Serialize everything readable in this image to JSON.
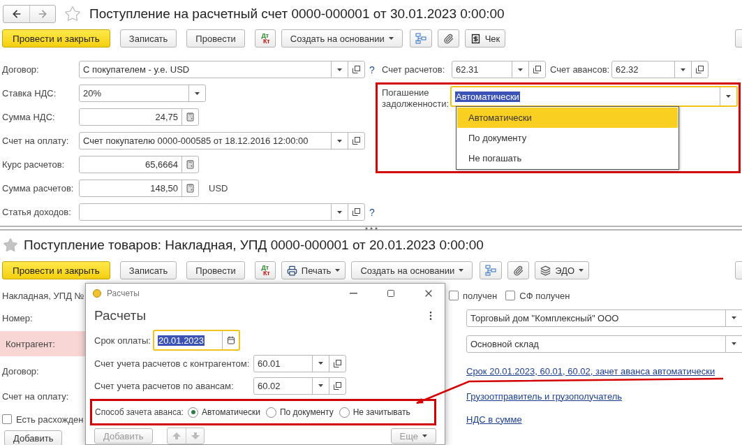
{
  "top_document": {
    "title": "Поступление на расчетный счет 0000-000001 от 30.01.2023 0:00:00",
    "toolbar": [
      {
        "kind": "primary",
        "label": "Провести и закрыть"
      },
      {
        "kind": "button",
        "label": "Записать"
      },
      {
        "kind": "button",
        "label": "Провести"
      },
      {
        "kind": "dtkt",
        "debit": "Дт",
        "credit": "Кт"
      },
      {
        "kind": "menu",
        "label": "Создать на основании"
      },
      {
        "kind": "structure"
      },
      {
        "kind": "clip"
      },
      {
        "kind": "receipt",
        "label": "Чек"
      },
      {
        "kind": "edge"
      }
    ],
    "fields": [
      {
        "kind": "ref",
        "label": "Договор:",
        "value": "С покупателем - у.е. USD",
        "help": "?"
      },
      {
        "kind": "choice",
        "label": "Ставка НДС:",
        "value": "20%"
      },
      {
        "kind": "number",
        "label": "Сумма НДС:",
        "value": "24,75"
      },
      {
        "kind": "ref",
        "label": "Счет на оплату:",
        "value": "Счет покупателю 0000-000585 от 18.12.2016 12:00:00"
      },
      {
        "kind": "number",
        "label": "Курс расчетов:",
        "value": "65,6664"
      },
      {
        "kind": "number",
        "label": "Сумма расчетов:",
        "value": "148,50",
        "unit": "USD"
      },
      {
        "kind": "ref",
        "label": "Статья доходов:",
        "help": "?"
      }
    ],
    "accounts": [
      {
        "label": "Счет расчетов:",
        "value": "62.31"
      },
      {
        "label": "Счет авансов:",
        "value": "62.32"
      }
    ],
    "repayment": {
      "label": "Погашение задолженности:",
      "value": "Автоматически",
      "options": [
        {
          "label": "Автоматически",
          "selected": true
        },
        {
          "label": "По документу",
          "selected": false
        },
        {
          "label": "Не погашать",
          "selected": false
        }
      ]
    }
  },
  "bottom_document": {
    "title": "Поступление товаров: Накладная, УПД 0000-000001 от 20.01.2023 0:00:00",
    "toolbar": [
      {
        "kind": "primary",
        "label": "Провести и закрыть"
      },
      {
        "kind": "button",
        "label": "Записать"
      },
      {
        "kind": "button",
        "label": "Провести"
      },
      {
        "kind": "dtkt",
        "debit": "Дт",
        "credit": "Кт"
      },
      {
        "kind": "printer",
        "label": "Печать"
      },
      {
        "kind": "menu",
        "label": "Создать на основании"
      },
      {
        "kind": "structure"
      },
      {
        "kind": "clip"
      },
      {
        "kind": "edo",
        "label": "ЭДО"
      },
      {
        "kind": "edge"
      }
    ],
    "labels": [
      {
        "label": "Накладная, УПД №",
        "highlighted": false
      },
      {
        "label": "Номер:",
        "highlighted": false
      },
      {
        "label": "Контрагент:",
        "highlighted": true
      },
      {
        "label": "Договор:",
        "highlighted": false
      },
      {
        "label": "Счет на оплату:",
        "highlighted": false
      }
    ],
    "discrepancy": {
      "label": "Есть расхожден",
      "checked": false
    },
    "add_button": "Добавить",
    "received": [
      {
        "label": "получен",
        "checked": false
      },
      {
        "label": "СФ получен",
        "checked": false
      }
    ],
    "fields": [
      {
        "value": "Торговый дом \"Комплексный\" ООО"
      },
      {
        "value": "Основной склад"
      }
    ],
    "links": [
      "Срок 20.01.2023, 60.01, 60.02, зачет аванса автоматически",
      "Грузоотправитель и грузополучатель",
      "НДС в сумме"
    ]
  },
  "dialog": {
    "title": "Расчеты",
    "heading": "Расчеты",
    "due_date": {
      "label": "Срок оплаты:",
      "value": "20.01.2023"
    },
    "accounts": [
      {
        "label": "Счет учета расчетов с контрагентом:",
        "value": "60.01"
      },
      {
        "label": "Счет учета расчетов по авансам:",
        "value": "60.02"
      }
    ],
    "advance": {
      "label": "Способ зачета аванса:",
      "options": [
        {
          "label": "Автоматически",
          "selected": true
        },
        {
          "label": "По документу",
          "selected": false
        },
        {
          "label": "Не зачитывать",
          "selected": false
        }
      ]
    },
    "add_button": "Добавить",
    "more_button": "Еще"
  }
}
